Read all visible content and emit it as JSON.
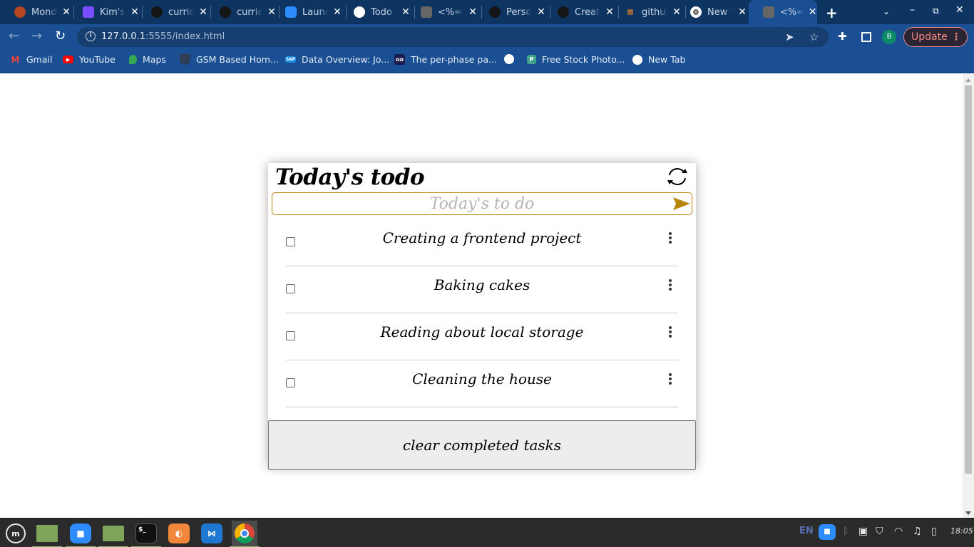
{
  "browser": {
    "tabs": [
      {
        "title": "Monday",
        "icon": "monday-icon",
        "icon_color": "#b7471e"
      },
      {
        "title": "Kim's",
        "icon": "miro-icon",
        "icon_color": "#7a4dff"
      },
      {
        "title": "curriculum",
        "icon": "github-icon",
        "icon_color": "#151515"
      },
      {
        "title": "curriculum",
        "icon": "github-icon",
        "icon_color": "#151515"
      },
      {
        "title": "Launch",
        "icon": "zoom-icon",
        "icon_color": "#2d8cff"
      },
      {
        "title": "Todo",
        "icon": "globe-icon",
        "icon_color": "#ffffff"
      },
      {
        "title": "<%= h",
        "icon": "radio-icon",
        "icon_color": "#666666"
      },
      {
        "title": "Personal",
        "icon": "github-icon",
        "icon_color": "#151515"
      },
      {
        "title": "Create",
        "icon": "github-icon",
        "icon_color": "#151515"
      },
      {
        "title": "github",
        "icon": "stackoverflow-icon",
        "icon_color": "#f48024"
      },
      {
        "title": "New Tab",
        "icon": "chrome-icon",
        "icon_color": "#ffffff"
      },
      {
        "title": "<%= h",
        "icon": "radio-icon",
        "icon_color": "#666666",
        "active": true
      }
    ],
    "new_tab_label": "+",
    "url_host": "127.0.0.1",
    "url_rest": ":5555/index.html",
    "profile_initial": "B",
    "update_label": "Update",
    "bookmarks": [
      {
        "label": "Gmail",
        "icon": "gmail-icon",
        "color": "#ea4335"
      },
      {
        "label": "YouTube",
        "icon": "youtube-icon",
        "color": "#ff0000"
      },
      {
        "label": "Maps",
        "icon": "maps-icon",
        "color": "#34a853"
      },
      {
        "label": "GSM Based Hom...",
        "icon": "shield-icon",
        "color": "#2f3e55"
      },
      {
        "label": "Data Overview: Jo...",
        "icon": "sap-icon",
        "color": "#1b8ee8"
      },
      {
        "label": "The per-phase pa...",
        "icon": "glasses-icon",
        "color": "#1a1a4e"
      },
      {
        "label": "",
        "icon": "globe-icon",
        "color": "#ffffff"
      },
      {
        "label": "Free Stock Photo...",
        "icon": "pexels-icon",
        "color": "#3fa389"
      },
      {
        "label": "New Tab",
        "icon": "globe-icon",
        "color": "#ffffff"
      }
    ]
  },
  "todo": {
    "title": "Today's todo",
    "input_placeholder": "Today's to do",
    "input_value": "",
    "accent_color": "#b8860b",
    "items": [
      {
        "text": "Creating a frontend project",
        "completed": false
      },
      {
        "text": "Baking cakes",
        "completed": false
      },
      {
        "text": "Reading about local storage",
        "completed": false
      },
      {
        "text": "Cleaning the house",
        "completed": false
      }
    ],
    "clear_label": "clear completed tasks"
  },
  "taskbar": {
    "apps": [
      "mint-menu",
      "show-desktop",
      "zoom",
      "files",
      "terminal",
      "firefox",
      "vscode",
      "chrome"
    ],
    "keyboard_layout": "EN",
    "clock": "18:05"
  }
}
